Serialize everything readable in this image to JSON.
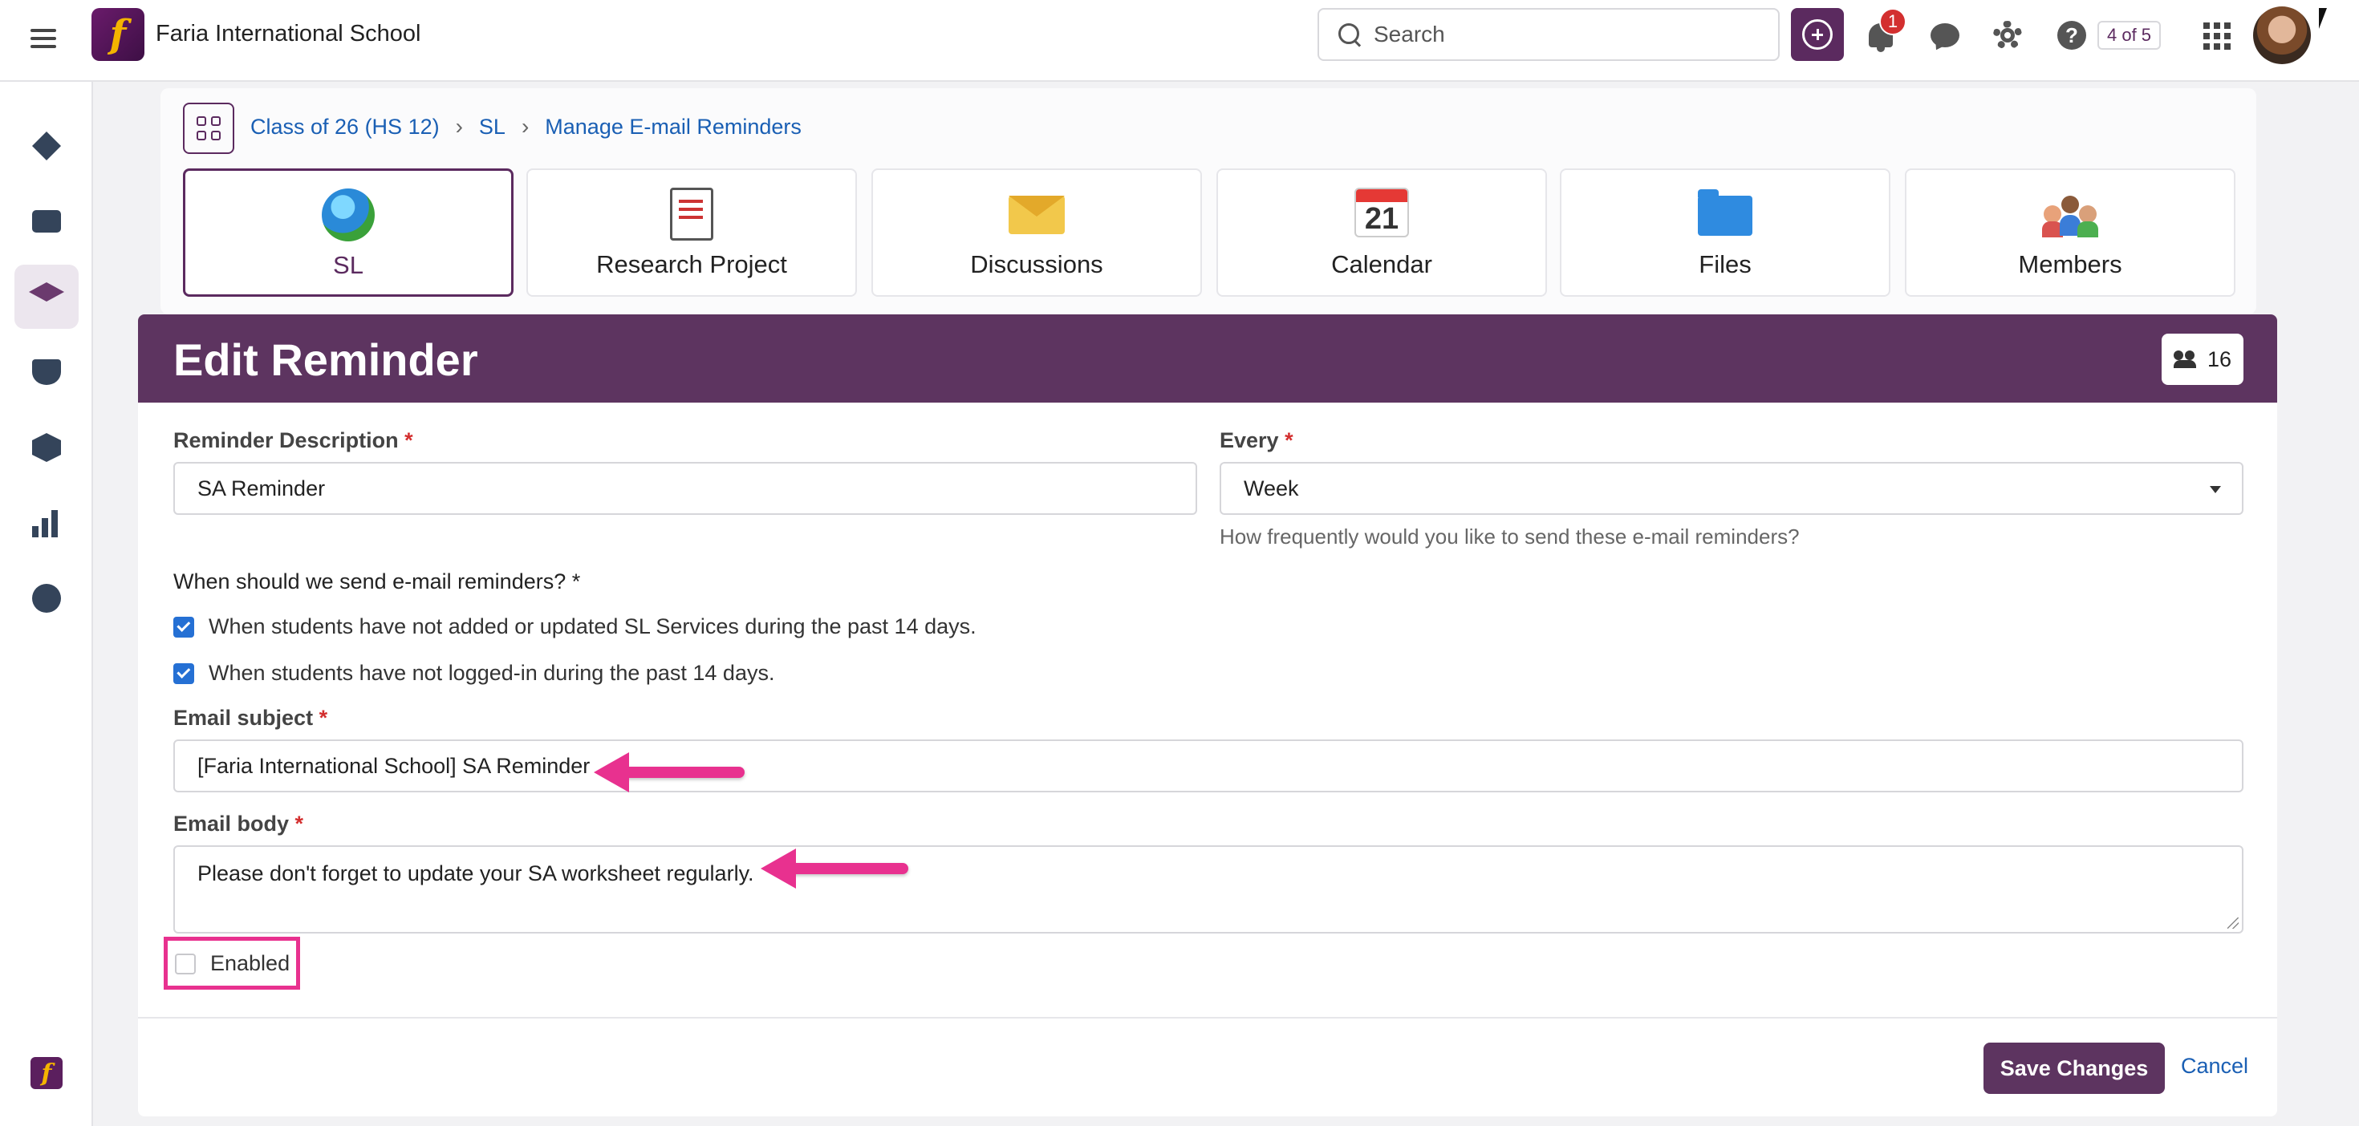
{
  "header": {
    "school_name": "Faria International School",
    "logo_letter": "f",
    "search_placeholder": "Search",
    "notification_count": "1",
    "pager": "4 of 5",
    "icons": [
      "menu-icon",
      "create-icon",
      "bell-icon",
      "chat-icon",
      "gear-icon",
      "help-icon",
      "apps-icon"
    ]
  },
  "rail": {
    "items": [
      "dashboard",
      "portfolio",
      "academics",
      "maps",
      "resources",
      "reports",
      "explore"
    ],
    "active": "academics"
  },
  "breadcrumb": {
    "items": [
      "Class of 26 (HS 12)",
      "SL",
      "Manage E-mail Reminders"
    ]
  },
  "tiles": [
    {
      "label": "SL",
      "icon": "globe-icon",
      "active": true
    },
    {
      "label": "Research Project",
      "icon": "notepad-icon",
      "active": false
    },
    {
      "label": "Discussions",
      "icon": "envelope-icon",
      "active": false
    },
    {
      "label": "Calendar",
      "icon": "calendar-icon",
      "active": false,
      "calendar_day": "21"
    },
    {
      "label": "Files",
      "icon": "folder-icon",
      "active": false
    },
    {
      "label": "Members",
      "icon": "people-icon",
      "active": false
    }
  ],
  "form": {
    "title": "Edit Reminder",
    "member_count": "16",
    "description_label": "Reminder Description",
    "description_value": "SA Reminder",
    "every_label": "Every",
    "every_value": "Week",
    "every_help": "How frequently would you like to send these e-mail reminders?",
    "when_label": "When should we send e-mail reminders? *",
    "conditions": [
      {
        "label": "When students have not added or updated SL Services during the past 14 days.",
        "checked": true
      },
      {
        "label": "When students have not logged-in during the past 14 days.",
        "checked": true
      }
    ],
    "subject_label": "Email subject",
    "subject_value": "[Faria International School] SA Reminder",
    "body_label": "Email body",
    "body_value": "Please don't forget to update your SA worksheet regularly.",
    "enabled_label": "Enabled",
    "enabled_checked": false,
    "required_mark": "*",
    "save_label": "Save Changes",
    "cancel_label": "Cancel"
  },
  "colors": {
    "brand": "#5d3460",
    "link": "#1a5fb4",
    "checkbox": "#2570d4",
    "annotation": "#e8318f",
    "required": "#d32f2f"
  }
}
